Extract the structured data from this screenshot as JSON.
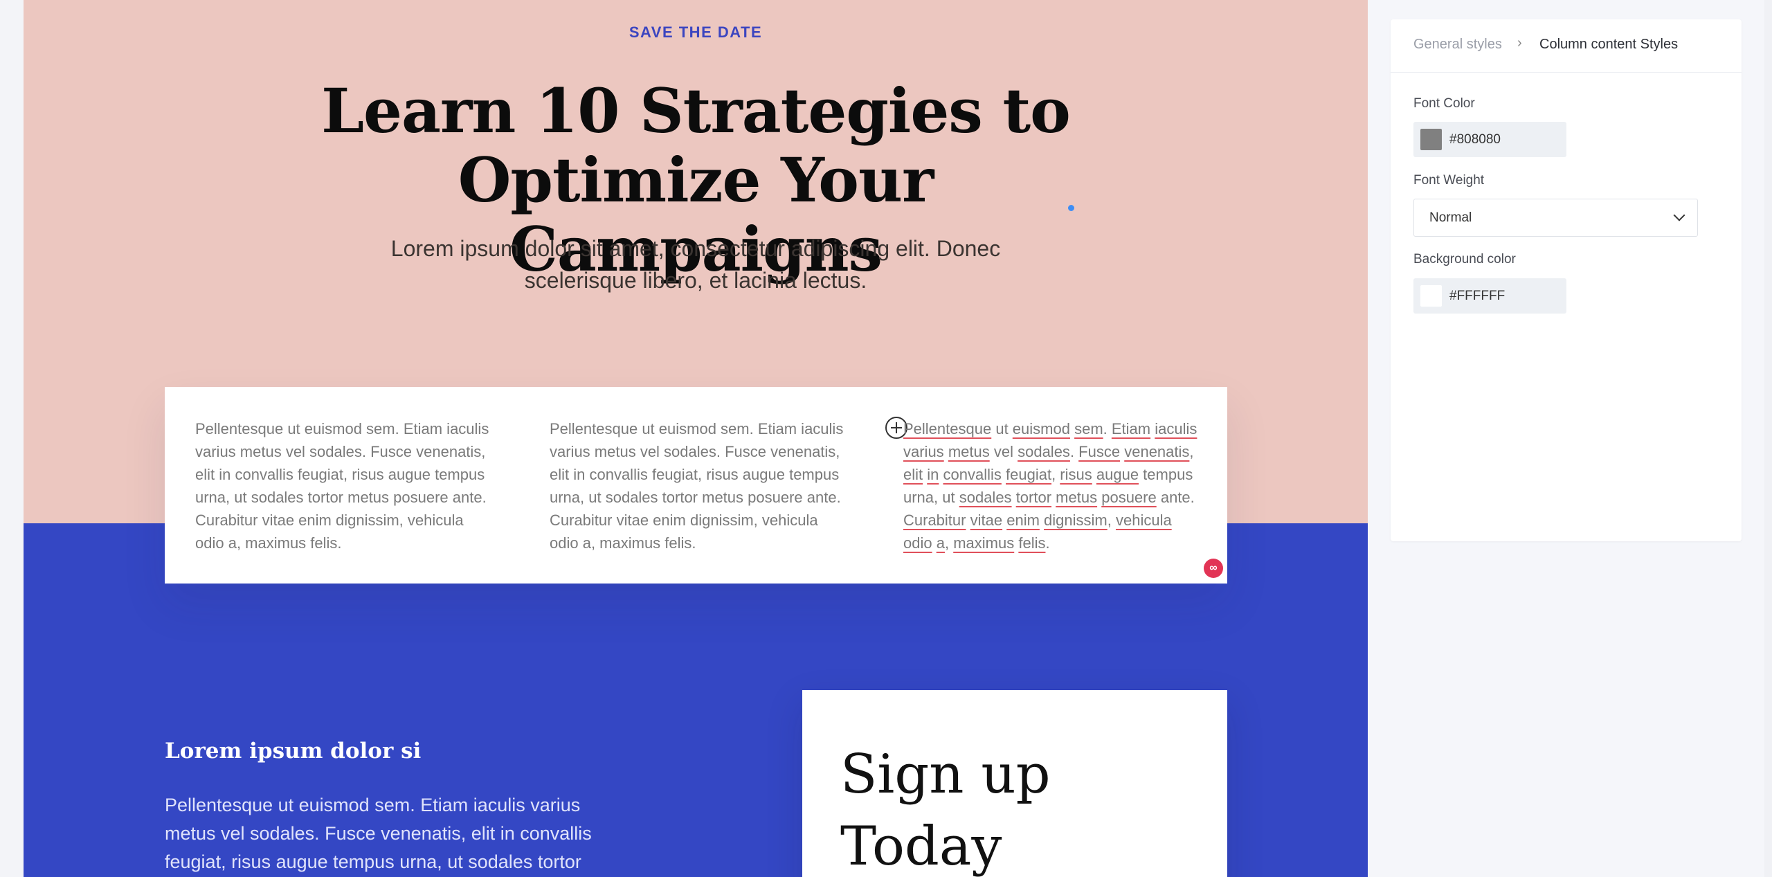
{
  "hero": {
    "eyebrow": "SAVE THE DATE",
    "headline": "Learn 10 Strategies to Optimize Your Campaigns",
    "subtitle": "Lorem ipsum dolor sit amet, consectetur adipiscing elit. Donec scelerisque libero, et lacinia lectus."
  },
  "columns": [
    {
      "text": "Pellentesque ut euismod sem. Etiam iaculis varius metus vel sodales. Fusce venenatis, elit in convallis feugiat, risus augue tempus urna, ut sodales tortor metus posuere ante. Curabitur vitae enim dignissim, vehicula odio a, maximus felis."
    },
    {
      "text": "Pellentesque ut euismod sem. Etiam iaculis varius metus vel sodales. Fusce venenatis, elit in convallis feugiat, risus augue tempus urna, ut sodales tortor metus posuere ante. Curabitur vitae enim dignissim, vehicula odio a, maximus felis."
    },
    {
      "text": "Pellentesque ut euismod sem. Etiam iaculis varius metus vel sodales. Fusce venenatis, elit in convallis feugiat, risus augue tempus urna, ut sodales tortor metus posuere ante. Curabitur vitae enim dignissim, vehicula odio a, maximus felis."
    }
  ],
  "grammar_badge": "∞",
  "lower": {
    "heading": "Lorem ipsum dolor si",
    "text": "Pellentesque ut euismod sem. Etiam iaculis varius metus vel sodales. Fusce venenatis, elit in convallis feugiat, risus augue tempus urna, ut sodales tortor"
  },
  "signup": {
    "title": "Sign up Today"
  },
  "panel": {
    "breadcrumb": {
      "parent": "General styles",
      "separator": "›",
      "current": "Column content Styles"
    },
    "font_color": {
      "label": "Font Color",
      "value": "#808080",
      "swatch": "#808080"
    },
    "font_weight": {
      "label": "Font Weight",
      "value": "Normal"
    },
    "background_color": {
      "label": "Background color",
      "value": "#FFFFFF",
      "swatch": "#FFFFFF"
    }
  },
  "colors": {
    "hero_bg": "#ECC7C0",
    "blue_bg": "#3447C4",
    "eyebrow": "#3B45C0",
    "spellcheck": "#E0505A"
  }
}
